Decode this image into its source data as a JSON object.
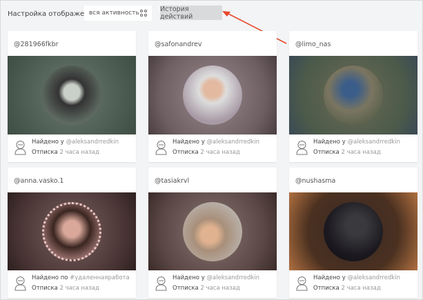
{
  "toolbar": {
    "label": "Настройка отображения",
    "filter_value": "вся активность",
    "history_button": "История действий",
    "accent": "#e8472b"
  },
  "cards": [
    {
      "username": "@281966fkbr",
      "found_prefix": "Найдено у",
      "found_by": "@aleksandrredkin",
      "status": "Отписка",
      "time": "2 часа назад"
    },
    {
      "username": "@safonandrev",
      "found_prefix": "Найдено у",
      "found_by": "@aleksandrredkin",
      "status": "Отписка",
      "time": "2 часа назад"
    },
    {
      "username": "@limo_nas",
      "found_prefix": "Найдено у",
      "found_by": "@aleksandrredkin",
      "status": "Отписка",
      "time": "2 часа назад"
    },
    {
      "username": "@anna.vasko.1",
      "found_prefix": "Найдено по",
      "found_by": "#удаленнаяработа",
      "status": "Отписка",
      "time": "2 часа назад"
    },
    {
      "username": "@tasiakrvl",
      "found_prefix": "Найдено у",
      "found_by": "@aleksandrredkin",
      "status": "Отписка",
      "time": "2 часа назад"
    },
    {
      "username": "@nushasma",
      "found_prefix": "Найдено у",
      "found_by": "@aleksandrredkin",
      "status": "Отписка",
      "time": "2 часа назад"
    }
  ]
}
